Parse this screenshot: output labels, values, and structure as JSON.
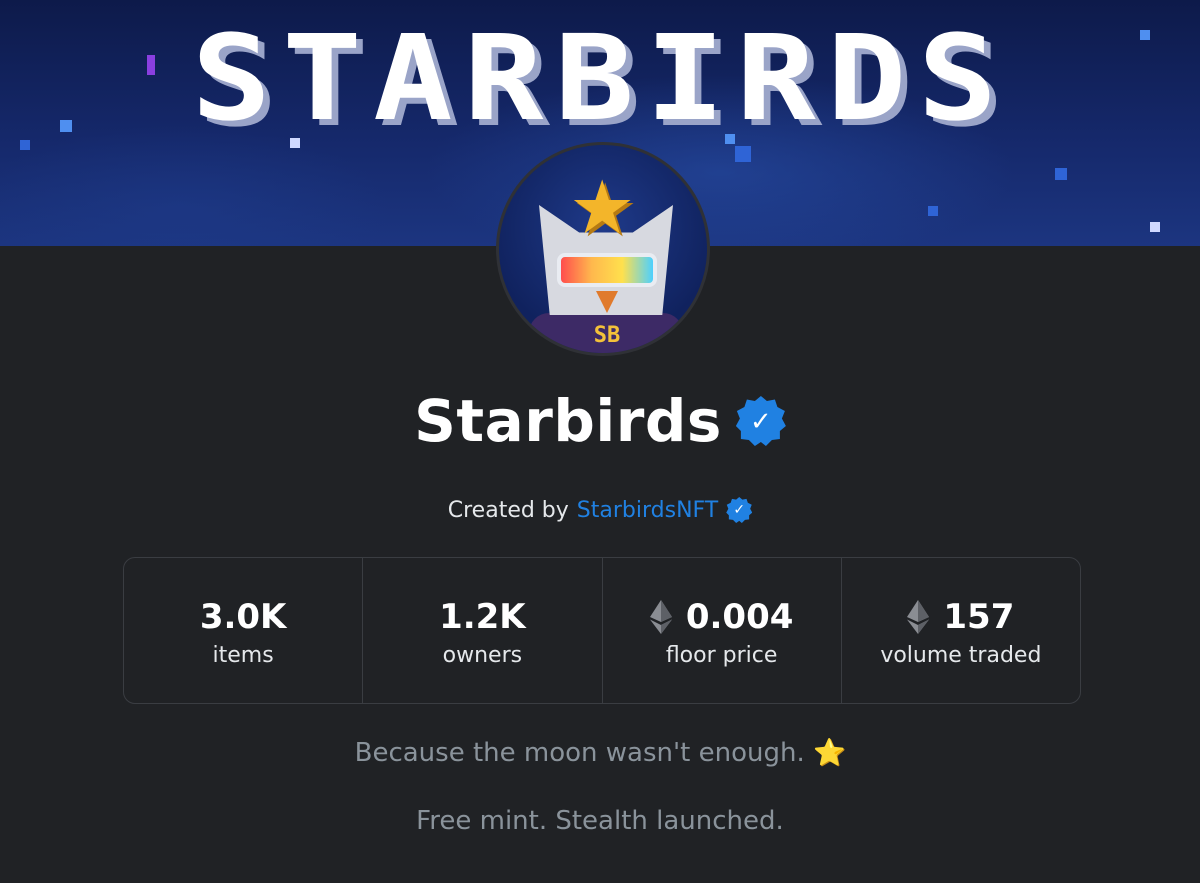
{
  "banner": {
    "title": "STARBIRDS"
  },
  "avatar": {
    "badge_text": "SB",
    "icon": "owl-avatar"
  },
  "collection": {
    "name": "Starbirds",
    "verified_icon": "verified-badge-icon",
    "badge_color": "#2081e2"
  },
  "creator": {
    "prefix": "Created by",
    "name": "StarbirdsNFT",
    "link_color": "#2081e2"
  },
  "stats": [
    {
      "value": "3.0K",
      "label": "items",
      "eth": false
    },
    {
      "value": "1.2K",
      "label": "owners",
      "eth": false
    },
    {
      "value": "0.004",
      "label": "floor price",
      "eth": true
    },
    {
      "value": "157",
      "label": "volume traded",
      "eth": true
    }
  ],
  "description": {
    "line1": "Because the moon wasn't enough.",
    "line1_emoji": "⭐",
    "line2": "Free mint. Stealth launched."
  },
  "colors": {
    "background": "#202225",
    "text_muted": "#8a939b"
  }
}
